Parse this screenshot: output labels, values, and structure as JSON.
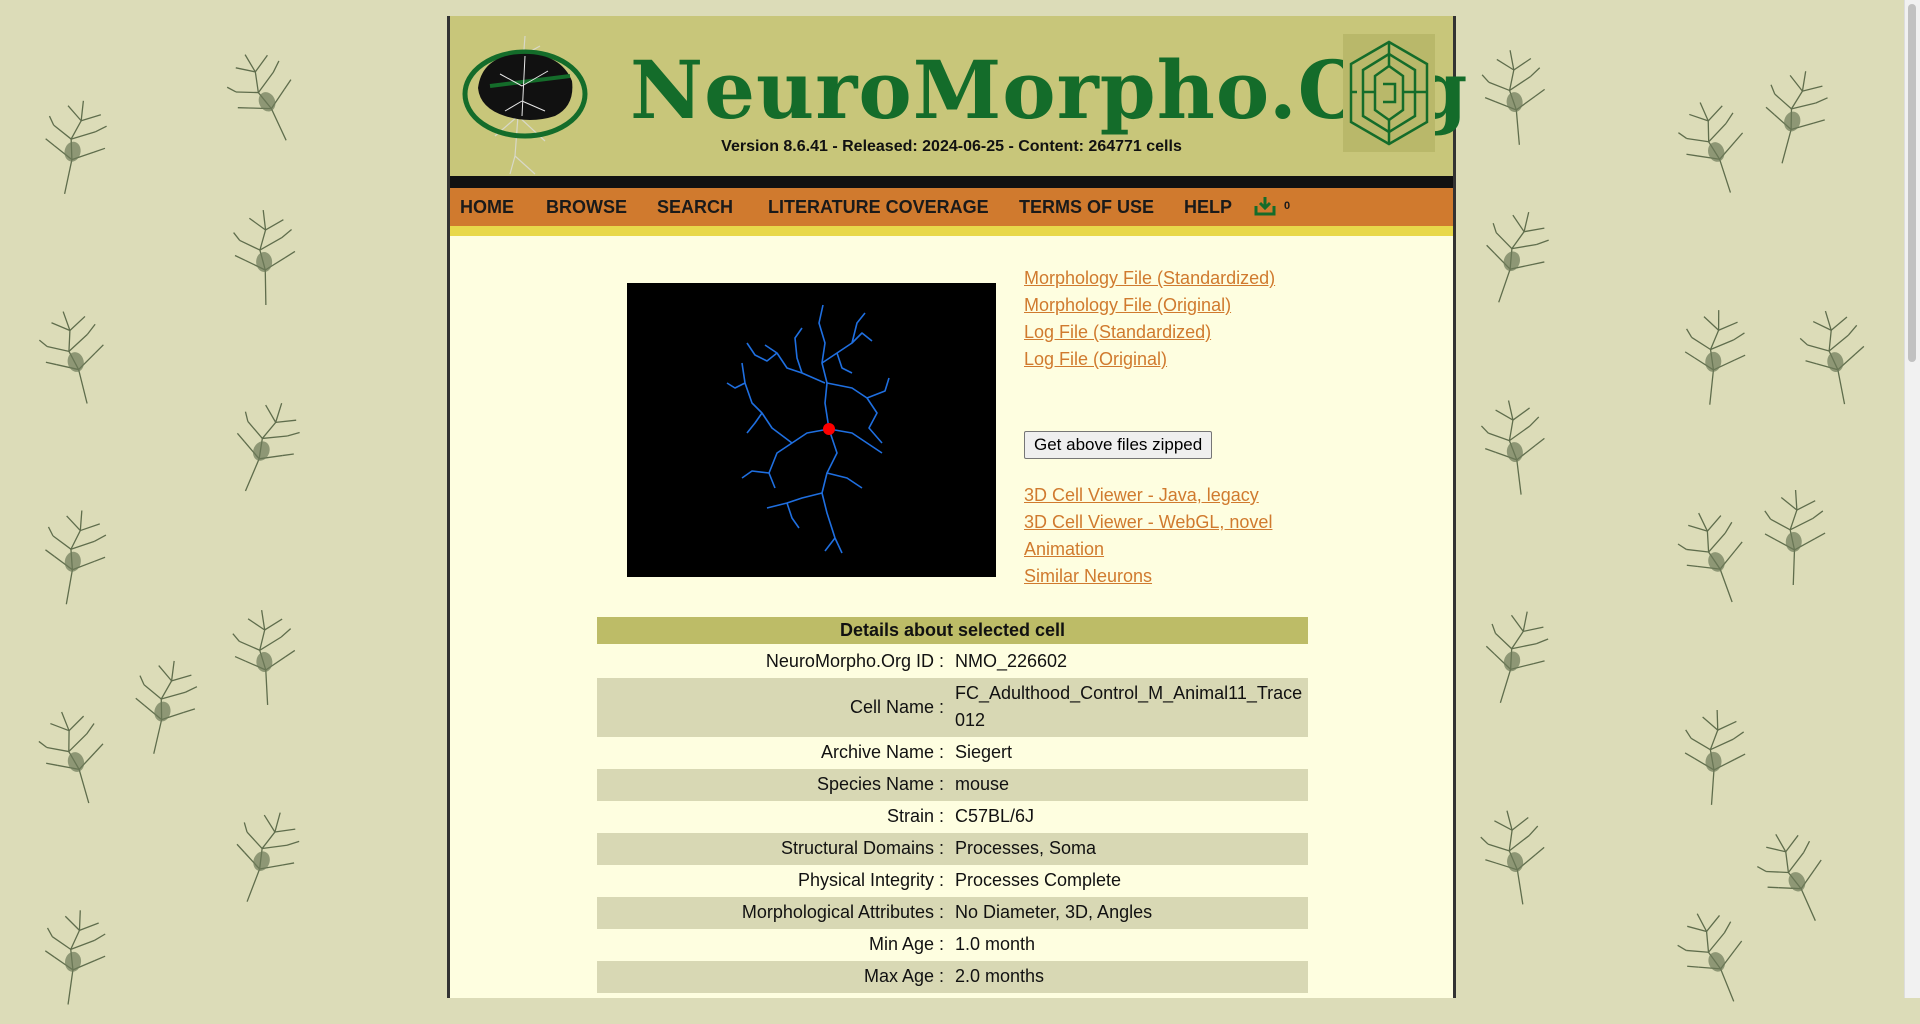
{
  "header": {
    "title": "NeuroMorpho.Org",
    "version": "Version 8.6.41 - Released: 2024-06-25 - Content: 264771 cells"
  },
  "nav": {
    "items": [
      "HOME",
      "BROWSE",
      "SEARCH",
      "LITERATURE COVERAGE",
      "TERMS OF USE",
      "HELP"
    ],
    "cart_icon": "download-tray-icon",
    "cart_count": "0"
  },
  "files": {
    "morph_std": "Morphology File (Standardized)",
    "morph_orig": "Morphology File (Original)",
    "log_std": "Log File (Standardized)",
    "log_orig": "Log File (Original)",
    "zip_button": "Get above files zipped",
    "viewer_java": "3D Cell Viewer - Java, legacy",
    "viewer_webgl": "3D Cell Viewer - WebGL, novel",
    "animation": "Animation",
    "similar": "Similar Neurons"
  },
  "details": {
    "heading": "Details about selected cell",
    "rows": [
      {
        "label": "NeuroMorpho.Org ID :",
        "value": "NMO_226602"
      },
      {
        "label": "Cell Name :",
        "value": "FC_Adulthood_Control_M_Animal11_Trace012"
      },
      {
        "label": "Archive Name :",
        "value": "Siegert"
      },
      {
        "label": "Species Name :",
        "value": "mouse"
      },
      {
        "label": "Strain :",
        "value": "C57BL/6J"
      },
      {
        "label": "Structural Domains :",
        "value": "Processes, Soma"
      },
      {
        "label": "Physical Integrity :",
        "value": "Processes Complete"
      },
      {
        "label": "Morphological Attributes :",
        "value": "No Diameter, 3D, Angles"
      },
      {
        "label": "Min Age :",
        "value": "1.0 month"
      },
      {
        "label": "Max Age :",
        "value": "2.0 months"
      }
    ]
  },
  "colors": {
    "header_bg": "#c8c67a",
    "nav_bg": "#d07a2e",
    "link": "#d07a2e",
    "title": "#146c2a",
    "neuron": "#1f6fe0",
    "soma": "#ff0000"
  }
}
